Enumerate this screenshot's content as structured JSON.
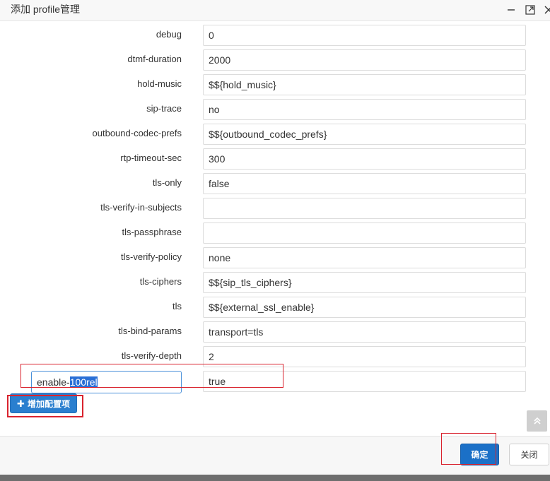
{
  "dialog": {
    "title": "添加 profile管理"
  },
  "rows": [
    {
      "label": "debug",
      "value": "0"
    },
    {
      "label": "dtmf-duration",
      "value": "2000"
    },
    {
      "label": "hold-music",
      "value": "$${hold_music}"
    },
    {
      "label": "sip-trace",
      "value": "no"
    },
    {
      "label": "outbound-codec-prefs",
      "value": "$${outbound_codec_prefs}"
    },
    {
      "label": "rtp-timeout-sec",
      "value": "300"
    },
    {
      "label": "tls-only",
      "value": "false"
    },
    {
      "label": "tls-verify-in-subjects",
      "value": ""
    },
    {
      "label": "tls-passphrase",
      "value": ""
    },
    {
      "label": "tls-verify-policy",
      "value": "none"
    },
    {
      "label": "tls-ciphers",
      "value": "$${sip_tls_ciphers}"
    },
    {
      "label": "tls",
      "value": "$${external_ssl_enable}"
    },
    {
      "label": "tls-bind-params",
      "value": "transport=tls"
    },
    {
      "label": "tls-verify-depth",
      "value": "2"
    }
  ],
  "custom_row": {
    "key_prefix": "enable-",
    "key_selected": "100rel",
    "value": "true"
  },
  "buttons": {
    "add_config": "增加配置项",
    "ok": "确定",
    "close": "关闭"
  },
  "colors": {
    "primary": "#1b70c7",
    "annotation": "#d9232e"
  }
}
